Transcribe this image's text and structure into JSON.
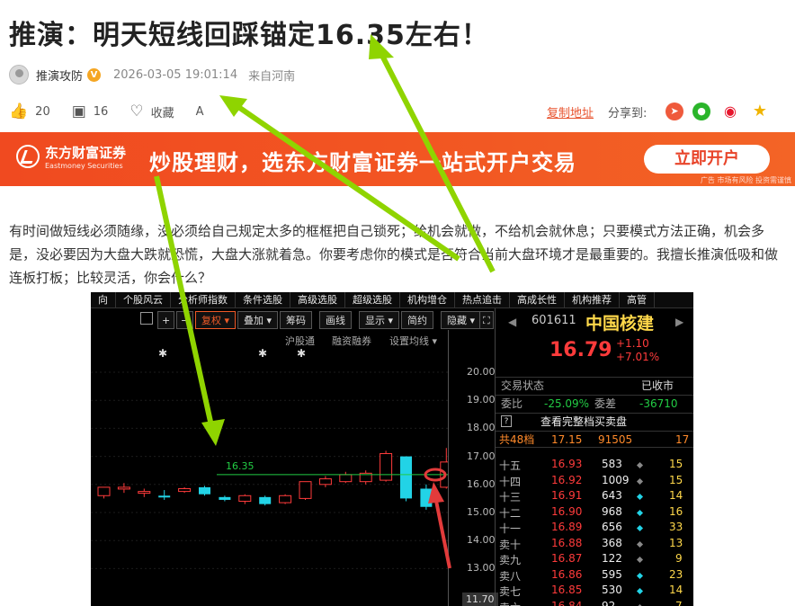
{
  "article": {
    "title": "推演：明天短线回踩锚定16.35左右！",
    "author": "推演攻防",
    "verified_badge": "V",
    "time": "2026-03-05 19:01:14",
    "location": "来自河南",
    "likes": "20",
    "comments": "16",
    "favorite_label": "收藏",
    "font_label": "A",
    "copy_link": "复制地址",
    "share_label": "分享到:",
    "body": "有时间做短线必须随缘，没必须给自己规定太多的框框把自己锁死；给机会就做，不给机会就休息；只要模式方法正确，机会多是，没必要因为大盘大跌就恐慌，大盘大涨就着急。你要考虑你的模式是否符合当前大盘环境才是最重要的。我擅长推演低吸和做连板打板；比较灵活，你会什么？"
  },
  "banner": {
    "logo_cn": "东方财富证券",
    "logo_en": "Eastmoney Securities",
    "slogan": "炒股理财，选东方财富证券一站式开户交易",
    "cta": "立即开户",
    "ad_note": "广告 市场有风险 投资需谨慎"
  },
  "terminal": {
    "menu": [
      "向",
      "个股风云",
      "分析师指数",
      "条件选股",
      "高级选股",
      "超级选股",
      "机构增仓",
      "热点追击",
      "高成长性",
      "机构推荐",
      "高管"
    ],
    "toolbar": {
      "minus": "−",
      "adjust": "复权",
      "overlay": "叠加",
      "chips": "筹码",
      "draw": "画线",
      "display": "显示",
      "simple": "简约",
      "hide": "隐藏"
    },
    "subbar": {
      "hgt": "沪股通",
      "margin": "融资融券",
      "ma_setting": "设置均线"
    },
    "annotation": "16.35",
    "stock": {
      "code": "601611",
      "name": "中国核建",
      "price": "16.79",
      "change": "+1.10",
      "change_pct": "+7.01%"
    },
    "status_label": "交易状态",
    "status_value": "已收市",
    "weibi_label": "委比",
    "weibi_value": "-25.09%",
    "weicha_label": "委差",
    "weicha_value": "-36710",
    "full_book_icon": "?",
    "full_book": "查看完整档买卖盘",
    "total": {
      "label": "共48档",
      "price": "17.15",
      "vol": "91505",
      "count": "17"
    },
    "asks": [
      {
        "label": "十五",
        "price": "16.93",
        "vol": "583",
        "count": "15"
      },
      {
        "label": "十四",
        "price": "16.92",
        "vol": "1009",
        "count": "15"
      },
      {
        "label": "十三",
        "price": "16.91",
        "vol": "643",
        "count": "14"
      },
      {
        "label": "十二",
        "price": "16.90",
        "vol": "968",
        "count": "16"
      },
      {
        "label": "十一",
        "price": "16.89",
        "vol": "656",
        "count": "33"
      },
      {
        "label": "卖十",
        "price": "16.88",
        "vol": "368",
        "count": "13"
      },
      {
        "label": "卖九",
        "price": "16.87",
        "vol": "122",
        "count": "9"
      },
      {
        "label": "卖八",
        "price": "16.86",
        "vol": "595",
        "count": "23"
      },
      {
        "label": "卖七",
        "price": "16.85",
        "vol": "530",
        "count": "14"
      },
      {
        "label": "卖六",
        "price": "16.84",
        "vol": "92",
        "count": "7"
      }
    ],
    "y_ticks": [
      "20.00",
      "19.00",
      "18.00",
      "17.00",
      "16.00",
      "15.00",
      "14.00",
      "13.00"
    ],
    "y_low": "11.70",
    "candles": [
      {
        "o": 15.6,
        "c": 15.9,
        "h": 15.9,
        "l": 15.5
      },
      {
        "o": 15.9,
        "c": 15.9,
        "h": 16.05,
        "l": 15.7
      },
      {
        "o": 15.7,
        "c": 15.75,
        "h": 15.85,
        "l": 15.55
      },
      {
        "o": 15.6,
        "c": 15.55,
        "h": 15.8,
        "l": 15.45
      },
      {
        "o": 15.75,
        "c": 15.85,
        "h": 15.9,
        "l": 15.7
      },
      {
        "o": 15.9,
        "c": 15.65,
        "h": 15.95,
        "l": 15.6
      },
      {
        "o": 15.55,
        "c": 15.45,
        "h": 15.6,
        "l": 15.4
      },
      {
        "o": 15.4,
        "c": 15.6,
        "h": 15.65,
        "l": 15.3
      },
      {
        "o": 15.55,
        "c": 15.3,
        "h": 15.6,
        "l": 15.25
      },
      {
        "o": 15.35,
        "c": 15.6,
        "h": 15.65,
        "l": 15.3
      },
      {
        "o": 15.5,
        "c": 16.1,
        "h": 16.1,
        "l": 15.45
      },
      {
        "o": 16.0,
        "c": 16.2,
        "h": 16.3,
        "l": 15.9
      },
      {
        "o": 16.1,
        "c": 16.35,
        "h": 16.45,
        "l": 16.05
      },
      {
        "o": 16.1,
        "c": 16.4,
        "h": 16.5,
        "l": 16.0
      },
      {
        "o": 16.15,
        "c": 17.1,
        "h": 17.2,
        "l": 16.1
      },
      {
        "o": 17.0,
        "c": 15.5,
        "h": 17.0,
        "l": 15.4
      },
      {
        "o": 15.85,
        "c": 15.2,
        "h": 16.0,
        "l": 15.1
      },
      {
        "o": 15.9,
        "c": 16.8,
        "h": 17.3,
        "l": 15.85
      }
    ],
    "colors": {
      "up": "#ff3b3b",
      "down": "#22d3e6",
      "line": "#22cc44"
    }
  }
}
